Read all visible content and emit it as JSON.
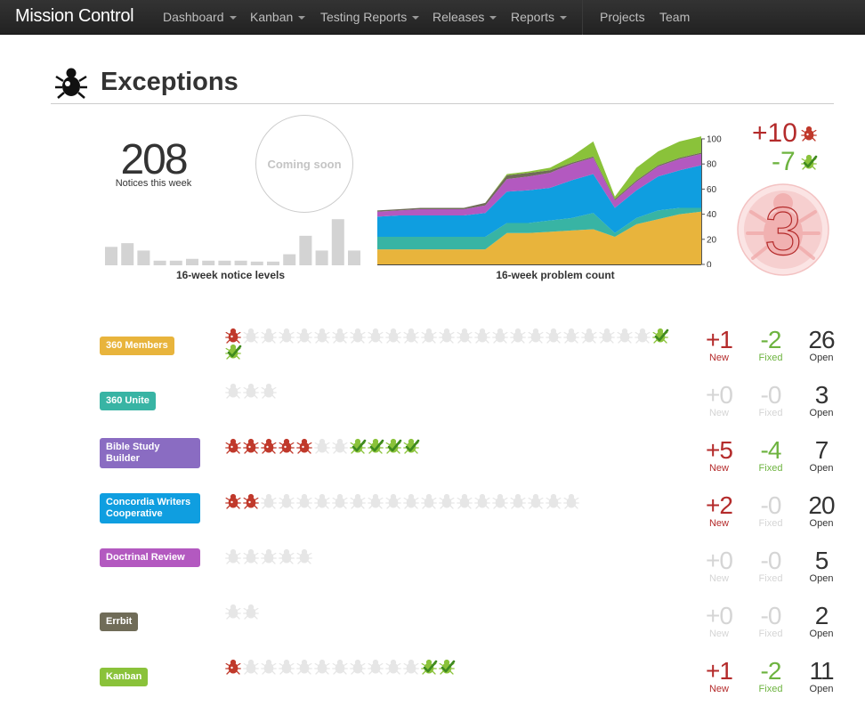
{
  "nav": {
    "brand": "Mission Control",
    "items": [
      {
        "label": "Dashboard",
        "dropdown": true
      },
      {
        "label": "Kanban",
        "dropdown": true
      },
      {
        "label": "Testing Reports",
        "dropdown": true
      },
      {
        "label": "Releases",
        "dropdown": true
      },
      {
        "label": "Reports",
        "dropdown": true
      },
      {
        "label": "Projects",
        "dropdown": false
      },
      {
        "label": "Team",
        "dropdown": false
      }
    ]
  },
  "page": {
    "title": "Exceptions",
    "title_icon": "bug-icon"
  },
  "summary": {
    "notice_count": "208",
    "notice_caption": "Notices this week",
    "coming_soon": "Coming soon",
    "notice_levels_caption": "16-week notice levels",
    "problem_count_caption": "16-week problem count",
    "new_total": "+10",
    "fixed_total": "-7",
    "open_total": "3"
  },
  "chart_data": [
    {
      "type": "bar",
      "title": "16-week notice levels",
      "categories": [
        "1",
        "2",
        "3",
        "4",
        "5",
        "6",
        "7",
        "8",
        "9",
        "10",
        "11",
        "12",
        "13",
        "14",
        "15",
        "16"
      ],
      "values": [
        20,
        24,
        16,
        5,
        5,
        7,
        5,
        5,
        5,
        4,
        4,
        12,
        32,
        16,
        50,
        16
      ],
      "color": "#d3d3d3"
    },
    {
      "type": "area",
      "title": "16-week problem count",
      "x": [
        1,
        2,
        3,
        4,
        5,
        6,
        7,
        8,
        9,
        10,
        11,
        12,
        13,
        14,
        15,
        16
      ],
      "ylim": [
        0,
        100
      ],
      "yticks": [
        0,
        20,
        40,
        60,
        80,
        100
      ],
      "series": [
        {
          "color": "#e8b43c",
          "values": [
            12,
            12,
            12,
            12,
            12,
            12,
            25,
            25,
            26,
            27,
            28,
            22,
            32,
            36,
            40,
            42
          ]
        },
        {
          "color": "#38b4a4",
          "values": [
            10,
            10,
            10,
            10,
            10,
            10,
            8,
            8,
            9,
            10,
            13,
            3,
            5,
            7,
            5,
            3
          ]
        },
        {
          "color": "#0f9ee0",
          "values": [
            16,
            17,
            17,
            17,
            17,
            19,
            25,
            26,
            26,
            30,
            31,
            20,
            22,
            27,
            30,
            34
          ]
        },
        {
          "color": "#b359c0",
          "values": [
            4,
            4,
            5,
            5,
            5,
            6,
            10,
            11,
            12,
            13,
            13,
            6,
            7,
            8,
            9,
            9
          ]
        },
        {
          "color": "#706c58",
          "values": [
            1,
            1,
            1,
            1,
            1,
            2,
            3,
            3,
            2,
            1,
            1,
            1,
            1,
            1,
            1,
            1
          ]
        },
        {
          "color": "#8ac23a",
          "values": [
            0,
            0,
            0,
            0,
            0,
            0,
            1,
            1,
            2,
            5,
            12,
            2,
            10,
            11,
            13,
            13
          ]
        }
      ]
    }
  ],
  "projects": [
    {
      "name": "360 Members",
      "color": "#e8b43c",
      "red": 1,
      "grey": 23,
      "green": 2,
      "new": "+1",
      "fixed": "-2",
      "open": "26",
      "new_active": true,
      "fixed_active": true
    },
    {
      "name": "360 Unite",
      "color": "#38b4a4",
      "red": 0,
      "grey": 3,
      "green": 0,
      "new": "+0",
      "fixed": "-0",
      "open": "3",
      "new_active": false,
      "fixed_active": false
    },
    {
      "name": "Bible Study Builder",
      "color": "#8a6cc2",
      "red": 5,
      "grey": 2,
      "green": 4,
      "new": "+5",
      "fixed": "-4",
      "open": "7",
      "new_active": true,
      "fixed_active": true
    },
    {
      "name": "Concordia Writers Cooperative",
      "color": "#0f9ee0",
      "red": 2,
      "grey": 18,
      "green": 0,
      "new": "+2",
      "fixed": "-0",
      "open": "20",
      "new_active": true,
      "fixed_active": false
    },
    {
      "name": "Doctrinal Review",
      "color": "#b359c0",
      "red": 0,
      "grey": 5,
      "green": 0,
      "new": "+0",
      "fixed": "-0",
      "open": "5",
      "new_active": false,
      "fixed_active": false
    },
    {
      "name": "Errbit",
      "color": "#706c58",
      "red": 0,
      "grey": 2,
      "green": 0,
      "new": "+0",
      "fixed": "-0",
      "open": "2",
      "new_active": false,
      "fixed_active": false
    },
    {
      "name": "Kanban",
      "color": "#8ac23a",
      "red": 1,
      "grey": 10,
      "green": 2,
      "new": "+1",
      "fixed": "-2",
      "open": "11",
      "new_active": true,
      "fixed_active": true
    }
  ],
  "labels": {
    "new": "New",
    "fixed": "Fixed",
    "open": "Open"
  },
  "colors": {
    "new": "#b42b2b",
    "fixed": "#6db33f",
    "muted": "#d5d5d5"
  }
}
